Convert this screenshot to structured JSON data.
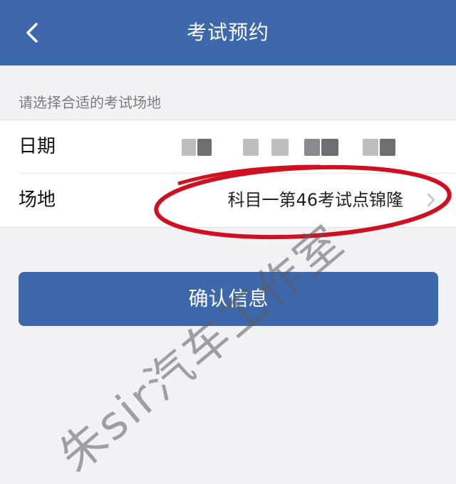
{
  "nav": {
    "title": "考试预约",
    "back_icon": "chevron-left-icon"
  },
  "hint": "请选择合适的考试场地",
  "form": {
    "date_label": "日期",
    "venue_label": "场地",
    "venue_value": "科目一第46考试点锦隆",
    "venue_chevron_icon": "chevron-right-icon"
  },
  "confirm_button_label": "确认信息",
  "watermark": "朱sir汽车工作室",
  "colors": {
    "primary": "#3d68ab",
    "background": "#f2f2f5",
    "annotation": "#d01020"
  }
}
